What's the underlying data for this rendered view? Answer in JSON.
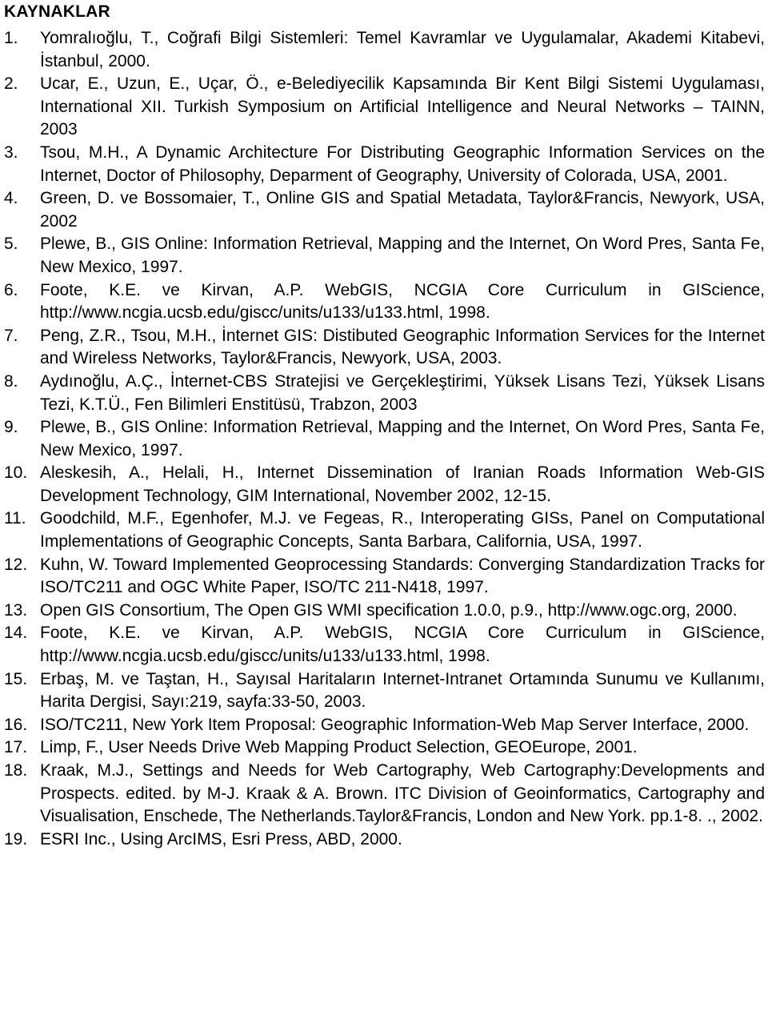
{
  "document": {
    "title": "KAYNAKLAR",
    "language": "tr",
    "references": [
      {
        "number": "1.",
        "text": "Yomralıoğlu, T., Coğrafi Bilgi Sistemleri: Temel Kavramlar ve Uygulamalar, Akademi Kitabevi, İstanbul, 2000."
      },
      {
        "number": "2.",
        "text": "Ucar, E., Uzun, E., Uçar, Ö., e-Belediyecilik Kapsamında Bir Kent Bilgi Sistemi Uygulaması, International XII. Turkish Symposium on Artificial Intelligence and Neural Networks – TAINN, 2003"
      },
      {
        "number": "3.",
        "text": "Tsou, M.H., A Dynamic Architecture For Distributing Geographic Information Services on the Internet, Doctor of Philosophy, Deparment of Geography, University of Colorada, USA, 2001."
      },
      {
        "number": "4.",
        "text": "Green, D. ve Bossomaier, T., Online GIS and Spatial Metadata, Taylor&Francis, Newyork, USA, 2002"
      },
      {
        "number": "5.",
        "text": "Plewe, B., GIS Online: Information Retrieval, Mapping and the Internet, On Word Pres, Santa Fe, New Mexico, 1997."
      },
      {
        "number": "6.",
        "text": "Foote, K.E. ve Kirvan, A.P. WebGIS, NCGIA Core Curriculum in GIScience, http://www.ncgia.ucsb.edu/giscc/units/u133/u133.html, 1998."
      },
      {
        "number": "7.",
        "text": "Peng, Z.R., Tsou, M.H., İnternet GIS: Distibuted Geographic Information Services for the Internet and Wireless Networks, Taylor&Francis, Newyork, USA, 2003."
      },
      {
        "number": "8.",
        "text": "Aydınoğlu, A.Ç., İnternet-CBS Stratejisi ve Gerçekleştirimi, Yüksek Lisans Tezi, Yüksek Lisans Tezi, K.T.Ü., Fen Bilimleri Enstitüsü, Trabzon, 2003"
      },
      {
        "number": "9.",
        "text": "Plewe, B., GIS Online: Information Retrieval, Mapping and the Internet, On Word Pres, Santa Fe, New Mexico, 1997."
      },
      {
        "number": "10.",
        "text": "Aleskesih, A., Helali, H., Internet Dissemination of Iranian Roads Information Web-GIS Development Technology, GIM International, November 2002, 12-15."
      },
      {
        "number": "11.",
        "text": "Goodchild, M.F., Egenhofer, M.J. ve Fegeas, R., Interoperating GISs, Panel on Computational Implementations of Geographic Concepts, Santa Barbara, California, USA, 1997."
      },
      {
        "number": "12.",
        "text": "Kuhn, W. Toward Implemented Geoprocessing Standards: Converging Standardization Tracks for ISO/TC211 and OGC White Paper, ISO/TC 211-N418, 1997."
      },
      {
        "number": "13.",
        "text": "Open GIS Consortium, The Open GIS WMI specification 1.0.0, p.9., http://www.ogc.org, 2000."
      },
      {
        "number": "14.",
        "text": "Foote, K.E. ve Kirvan, A.P. WebGIS, NCGIA Core Curriculum in GIScience, http://www.ncgia.ucsb.edu/giscc/units/u133/u133.html, 1998."
      },
      {
        "number": "15.",
        "text": "Erbaş, M. ve Taştan, H., Sayısal Haritaların Internet-Intranet Ortamında Sunumu ve Kullanımı, Harita Dergisi, Sayı:219, sayfa:33-50, 2003."
      },
      {
        "number": "16.",
        "text": "ISO/TC211, New York Item Proposal: Geographic Information-Web Map Server Interface, 2000."
      },
      {
        "number": "17.",
        "text": "Limp, F., User Needs Drive Web Mapping Product Selection, GEOEurope, 2001."
      },
      {
        "number": "18.",
        "text": "Kraak, M.J., Settings and Needs for Web Cartography, Web Cartography:Developments and Prospects. edited. by M-J. Kraak & A. Brown. ITC Division of Geoinformatics, Cartography and Visualisation, Enschede, The Netherlands.Taylor&Francis, London and New York. pp.1-8. ., 2002."
      },
      {
        "number": "19.",
        "text": "ESRI Inc., Using ArcIMS, Esri Press, ABD, 2000."
      }
    ]
  }
}
